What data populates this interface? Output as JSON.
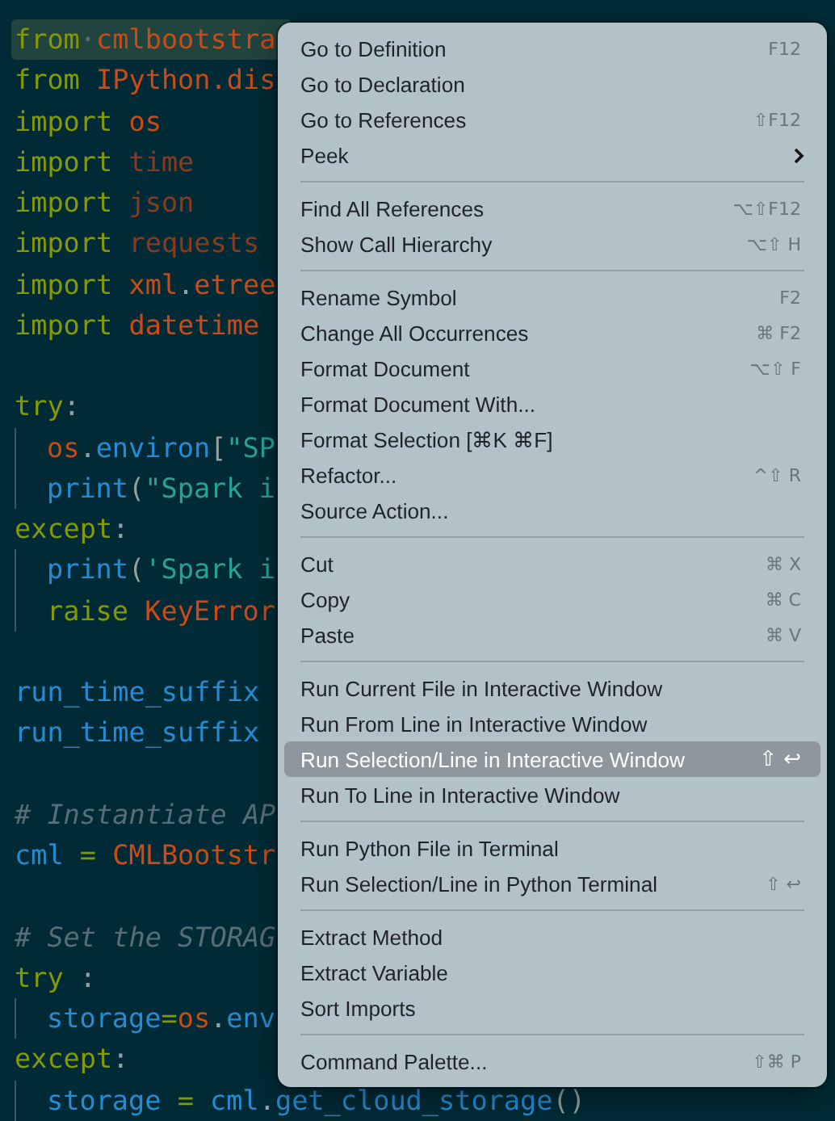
{
  "editor": {
    "lines": [
      {
        "highlighted": true,
        "indented": false,
        "tokens": [
          {
            "text": "from",
            "kind": "keyword"
          },
          {
            "text": "·",
            "kind": "whitespace"
          },
          {
            "text": "cmlbootstra",
            "kind": "module"
          }
        ]
      },
      {
        "highlighted": false,
        "indented": false,
        "tokens": [
          {
            "text": "from ",
            "kind": "keyword"
          },
          {
            "text": "IPython.dis",
            "kind": "module"
          }
        ]
      },
      {
        "highlighted": false,
        "indented": false,
        "tokens": [
          {
            "text": "import ",
            "kind": "keyword"
          },
          {
            "text": "os",
            "kind": "module"
          }
        ]
      },
      {
        "highlighted": false,
        "indented": false,
        "tokens": [
          {
            "text": "import ",
            "kind": "keyword"
          },
          {
            "text": "time",
            "kind": "dim"
          }
        ]
      },
      {
        "highlighted": false,
        "indented": false,
        "tokens": [
          {
            "text": "import ",
            "kind": "keyword"
          },
          {
            "text": "json",
            "kind": "dim"
          }
        ]
      },
      {
        "highlighted": false,
        "indented": false,
        "tokens": [
          {
            "text": "import ",
            "kind": "keyword"
          },
          {
            "text": "requests",
            "kind": "dim"
          }
        ]
      },
      {
        "highlighted": false,
        "indented": false,
        "tokens": [
          {
            "text": "import ",
            "kind": "keyword"
          },
          {
            "text": "xml",
            "kind": "module"
          },
          {
            "text": ".",
            "kind": "punct"
          },
          {
            "text": "etree",
            "kind": "module"
          }
        ]
      },
      {
        "highlighted": false,
        "indented": false,
        "tokens": [
          {
            "text": "import ",
            "kind": "keyword"
          },
          {
            "text": "datetime",
            "kind": "module"
          }
        ]
      },
      {
        "highlighted": false,
        "indented": false
      },
      {
        "highlighted": false,
        "indented": false,
        "tokens": [
          {
            "text": "try",
            "kind": "keyword"
          },
          {
            "text": ":",
            "kind": "punct"
          }
        ]
      },
      {
        "highlighted": false,
        "indented": true,
        "tokens": [
          {
            "text": "os",
            "kind": "module"
          },
          {
            "text": ".",
            "kind": "punct"
          },
          {
            "text": "environ",
            "kind": "func"
          },
          {
            "text": "[",
            "kind": "punct"
          },
          {
            "text": "\"SP",
            "kind": "string"
          }
        ]
      },
      {
        "highlighted": false,
        "indented": true,
        "tokens": [
          {
            "text": "print",
            "kind": "func"
          },
          {
            "text": "(",
            "kind": "punct"
          },
          {
            "text": "\"Spark i",
            "kind": "string"
          }
        ]
      },
      {
        "highlighted": false,
        "indented": false,
        "tokens": [
          {
            "text": "except",
            "kind": "keyword"
          },
          {
            "text": ":",
            "kind": "punct"
          }
        ]
      },
      {
        "highlighted": false,
        "indented": true,
        "tokens": [
          {
            "text": "print",
            "kind": "func"
          },
          {
            "text": "(",
            "kind": "punct"
          },
          {
            "text": "'Spark i",
            "kind": "string"
          }
        ]
      },
      {
        "highlighted": false,
        "indented": true,
        "tokens": [
          {
            "text": "raise ",
            "kind": "keyword"
          },
          {
            "text": "KeyError",
            "kind": "module"
          }
        ]
      },
      {
        "highlighted": false,
        "indented": false
      },
      {
        "highlighted": false,
        "indented": false,
        "tokens": [
          {
            "text": "run_time_suffix",
            "kind": "func"
          }
        ]
      },
      {
        "highlighted": false,
        "indented": false,
        "tokens": [
          {
            "text": "run_time_suffix",
            "kind": "func"
          }
        ]
      },
      {
        "highlighted": false,
        "indented": false
      },
      {
        "highlighted": false,
        "indented": false,
        "tokens": [
          {
            "text": "# Instantiate AP",
            "kind": "comment"
          }
        ]
      },
      {
        "highlighted": false,
        "indented": false,
        "tokens": [
          {
            "text": "cml ",
            "kind": "func"
          },
          {
            "text": "= ",
            "kind": "keyword"
          },
          {
            "text": "CMLBootstr",
            "kind": "module"
          }
        ]
      },
      {
        "highlighted": false,
        "indented": false
      },
      {
        "highlighted": false,
        "indented": false,
        "tokens": [
          {
            "text": "# Set the STORAG",
            "kind": "comment"
          }
        ]
      },
      {
        "highlighted": false,
        "indented": false,
        "tokens": [
          {
            "text": "try ",
            "kind": "keyword"
          },
          {
            "text": ":",
            "kind": "punct"
          }
        ]
      },
      {
        "highlighted": false,
        "indented": true,
        "tokens": [
          {
            "text": "storage",
            "kind": "func"
          },
          {
            "text": "=",
            "kind": "keyword"
          },
          {
            "text": "os",
            "kind": "module"
          },
          {
            "text": ".",
            "kind": "punct"
          },
          {
            "text": "env",
            "kind": "func"
          }
        ]
      },
      {
        "highlighted": false,
        "indented": false,
        "tokens": [
          {
            "text": "except",
            "kind": "keyword"
          },
          {
            "text": ":",
            "kind": "punct"
          }
        ]
      },
      {
        "highlighted": false,
        "indented": true,
        "tokens": [
          {
            "text": "storage ",
            "kind": "func"
          },
          {
            "text": "= ",
            "kind": "keyword"
          },
          {
            "text": "cml",
            "kind": "func"
          },
          {
            "text": ".",
            "kind": "punct"
          },
          {
            "text": "get_cloud_storage",
            "kind": "func"
          },
          {
            "text": "()",
            "kind": "punct"
          }
        ]
      }
    ]
  },
  "context_menu": {
    "groups": [
      [
        {
          "label": "Go to Definition",
          "shortcut": "F12",
          "submenu": false,
          "selected": false
        },
        {
          "label": "Go to Declaration",
          "submenu": false,
          "selected": false
        },
        {
          "label": "Go to References",
          "shortcut": "⇧F12",
          "submenu": false,
          "selected": false
        },
        {
          "label": "Peek",
          "submenu": true,
          "selected": false
        }
      ],
      [
        {
          "label": "Find All References",
          "shortcut": "⌥⇧F12",
          "submenu": false,
          "selected": false
        },
        {
          "label": "Show Call Hierarchy",
          "shortcut": "⌥⇧ H",
          "submenu": false,
          "selected": false
        }
      ],
      [
        {
          "label": "Rename Symbol",
          "shortcut": "F2",
          "submenu": false,
          "selected": false
        },
        {
          "label": "Change All Occurrences",
          "shortcut": "⌘ F2",
          "submenu": false,
          "selected": false
        },
        {
          "label": "Format Document",
          "shortcut": "⌥⇧ F",
          "submenu": false,
          "selected": false
        },
        {
          "label": "Format Document With...",
          "submenu": false,
          "selected": false
        },
        {
          "label": "Format Selection [⌘K ⌘F]",
          "submenu": false,
          "selected": false
        },
        {
          "label": "Refactor...",
          "shortcut": "^⇧ R",
          "submenu": false,
          "selected": false
        },
        {
          "label": "Source Action...",
          "submenu": false,
          "selected": false
        }
      ],
      [
        {
          "label": "Cut",
          "shortcut": "⌘ X",
          "submenu": false,
          "selected": false
        },
        {
          "label": "Copy",
          "shortcut": "⌘ C",
          "submenu": false,
          "selected": false
        },
        {
          "label": "Paste",
          "shortcut": "⌘ V",
          "submenu": false,
          "selected": false
        }
      ],
      [
        {
          "label": "Run Current File in Interactive Window",
          "submenu": false,
          "selected": false
        },
        {
          "label": "Run From Line in Interactive Window",
          "submenu": false,
          "selected": false
        },
        {
          "label": "Run Selection/Line in Interactive Window",
          "shortcut": "⇧ ↩",
          "submenu": false,
          "selected": true
        },
        {
          "label": "Run To Line in Interactive Window",
          "submenu": false,
          "selected": false
        }
      ],
      [
        {
          "label": "Run Python File in Terminal",
          "submenu": false,
          "selected": false
        },
        {
          "label": "Run Selection/Line in Python Terminal",
          "shortcut": "⇧ ↩",
          "submenu": false,
          "selected": false
        }
      ],
      [
        {
          "label": "Extract Method",
          "submenu": false,
          "selected": false
        },
        {
          "label": "Extract Variable",
          "submenu": false,
          "selected": false
        },
        {
          "label": "Sort Imports",
          "submenu": false,
          "selected": false
        }
      ],
      [
        {
          "label": "Command Palette...",
          "shortcut": "⇧⌘ P",
          "submenu": false,
          "selected": false
        }
      ]
    ]
  }
}
